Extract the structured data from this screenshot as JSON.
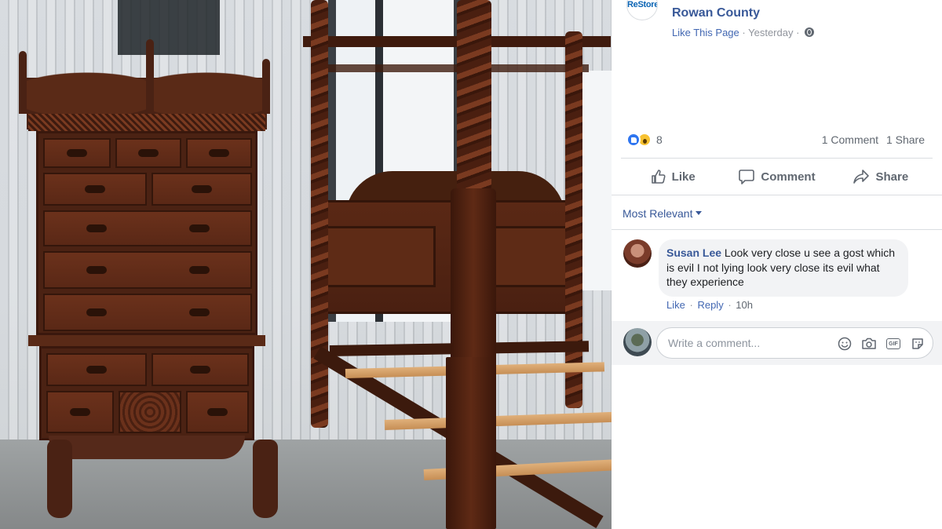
{
  "post": {
    "page_logo_text": "ReStore",
    "page_name": "Rowan County",
    "like_page_label": "Like This Page",
    "separator": "·",
    "timestamp": "Yesterday",
    "privacy_icon": "globe-icon"
  },
  "stats": {
    "reaction_icons": [
      "like-reaction-icon",
      "wow-reaction-icon"
    ],
    "reaction_count": "8",
    "comments_count": "1 Comment",
    "shares_count": "1 Share"
  },
  "actions": {
    "like": "Like",
    "comment": "Comment",
    "share": "Share"
  },
  "sort": {
    "label": "Most Relevant"
  },
  "comments": [
    {
      "author": "Susan Lee",
      "text": "Look very close u see a gost which is evil I not lying look very close its evil what they experience",
      "like_label": "Like",
      "reply_label": "Reply",
      "separator": "·",
      "time": "10h"
    }
  ],
  "composer": {
    "placeholder": "Write a comment...",
    "icons": [
      "emoji-icon",
      "camera-icon",
      "gif-icon",
      "sticker-icon"
    ],
    "gif_label": "GIF"
  },
  "colors": {
    "link_blue": "#385898",
    "action_gray": "#606770",
    "like_blue": "#2e75f0",
    "wow_yellow": "#f7c232"
  }
}
